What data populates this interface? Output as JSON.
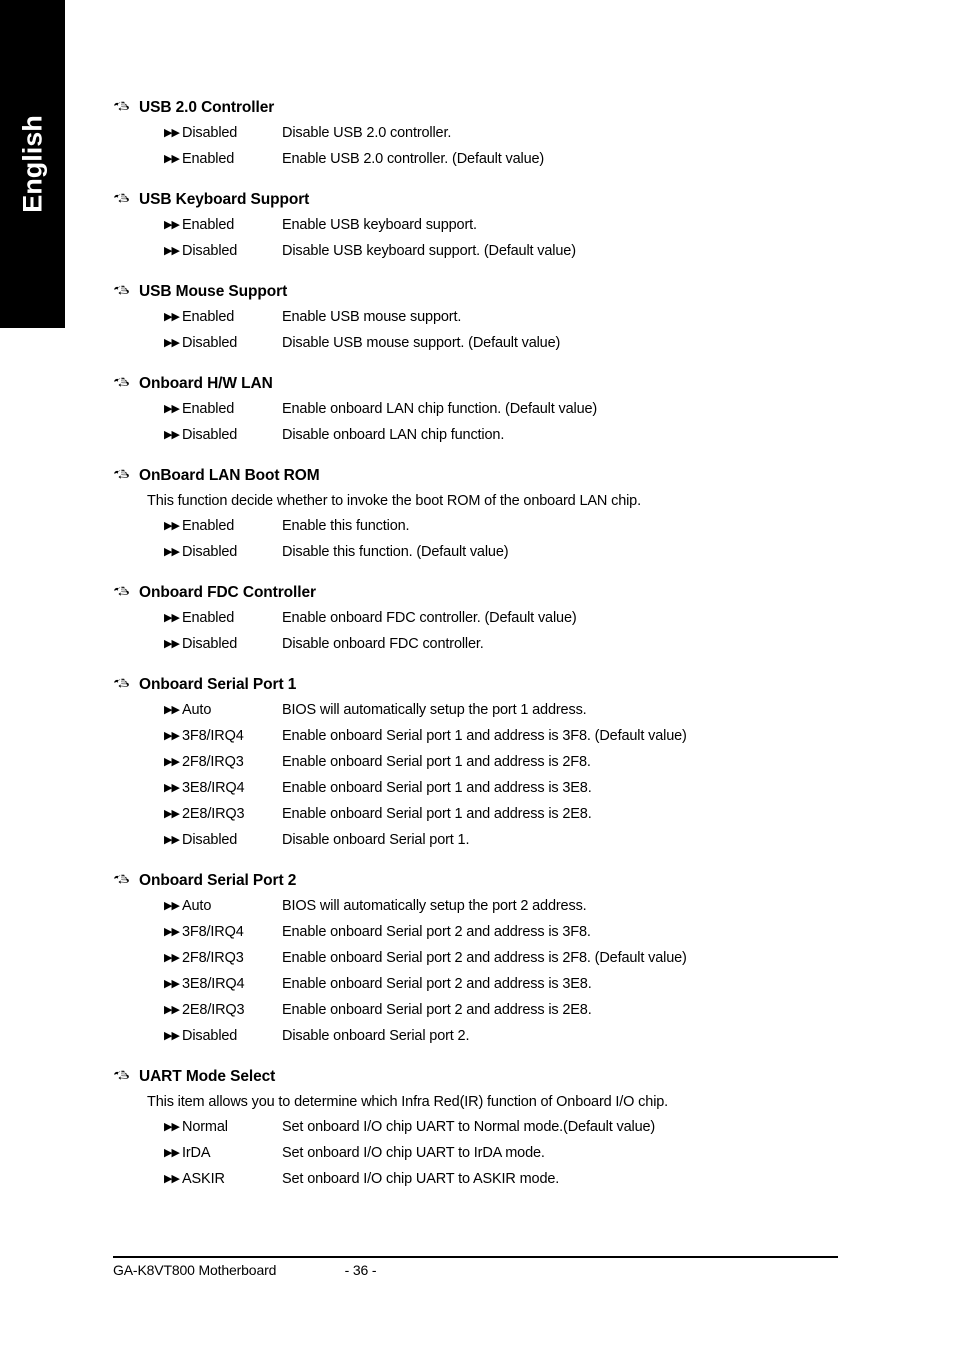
{
  "page": {
    "language_tab": "English",
    "heading_bullet_icon": "pointing-hand-icon",
    "option_bullet_icon": "double-triangle-right-icon"
  },
  "footer": {
    "product": "GA-K8VT800 Motherboard",
    "page_number": "- 36 -"
  },
  "sections": [
    {
      "title": "USB 2.0 Controller",
      "note": "",
      "options": [
        {
          "name": "Disabled",
          "desc": "Disable USB 2.0 controller."
        },
        {
          "name": "Enabled",
          "desc": "Enable USB 2.0 controller. (Default value)"
        }
      ]
    },
    {
      "title": "USB Keyboard Support",
      "note": "",
      "options": [
        {
          "name": "Enabled",
          "desc": "Enable USB keyboard support."
        },
        {
          "name": "Disabled",
          "desc": "Disable USB keyboard support. (Default value)"
        }
      ]
    },
    {
      "title": "USB Mouse Support",
      "note": "",
      "options": [
        {
          "name": "Enabled",
          "desc": "Enable USB mouse support."
        },
        {
          "name": "Disabled",
          "desc": "Disable USB mouse support. (Default value)"
        }
      ]
    },
    {
      "title": "Onboard H/W LAN",
      "note": "",
      "options": [
        {
          "name": "Enabled",
          "desc": "Enable onboard LAN chip function. (Default value)"
        },
        {
          "name": "Disabled",
          "desc": "Disable onboard LAN chip function."
        }
      ]
    },
    {
      "title": "OnBoard LAN Boot ROM",
      "note": "This function decide whether to invoke the boot ROM of the onboard LAN chip.",
      "options": [
        {
          "name": "Enabled",
          "desc": "Enable this function."
        },
        {
          "name": "Disabled",
          "desc": "Disable this function. (Default value)"
        }
      ]
    },
    {
      "title": "Onboard FDC Controller",
      "note": "",
      "options": [
        {
          "name": "Enabled",
          "desc": "Enable onboard FDC controller. (Default value)"
        },
        {
          "name": "Disabled",
          "desc": "Disable onboard FDC controller."
        }
      ]
    },
    {
      "title": "Onboard Serial Port 1",
      "note": "",
      "options": [
        {
          "name": "Auto",
          "desc": "BIOS will automatically setup the port 1 address."
        },
        {
          "name": "3F8/IRQ4",
          "desc": "Enable onboard Serial port 1 and address is 3F8. (Default value)"
        },
        {
          "name": "2F8/IRQ3",
          "desc": "Enable onboard Serial port 1 and address is 2F8."
        },
        {
          "name": "3E8/IRQ4",
          "desc": "Enable onboard Serial port 1 and address is 3E8."
        },
        {
          "name": "2E8/IRQ3",
          "desc": "Enable onboard Serial port 1 and address is 2E8."
        },
        {
          "name": "Disabled",
          "desc": "Disable onboard Serial port 1."
        }
      ]
    },
    {
      "title": "Onboard Serial Port 2",
      "note": "",
      "options": [
        {
          "name": "Auto",
          "desc": "BIOS will automatically setup the port 2 address."
        },
        {
          "name": "3F8/IRQ4",
          "desc": "Enable onboard Serial port 2 and address is 3F8."
        },
        {
          "name": "2F8/IRQ3",
          "desc": "Enable onboard Serial port 2 and address is 2F8. (Default value)"
        },
        {
          "name": "3E8/IRQ4",
          "desc": "Enable onboard Serial port 2 and address is 3E8."
        },
        {
          "name": "2E8/IRQ3",
          "desc": "Enable onboard Serial port 2 and address is 2E8."
        },
        {
          "name": "Disabled",
          "desc": "Disable onboard Serial port 2."
        }
      ]
    },
    {
      "title": "UART Mode Select",
      "note": "This item allows you to determine which Infra Red(IR) function of Onboard I/O chip.",
      "options": [
        {
          "name": "Normal",
          "desc": "Set onboard I/O chip UART to Normal mode.(Default value)"
        },
        {
          "name": "IrDA",
          "desc": "Set onboard I/O chip UART to IrDA mode."
        },
        {
          "name": "ASKIR",
          "desc": "Set onboard I/O chip UART to ASKIR mode."
        }
      ]
    }
  ]
}
